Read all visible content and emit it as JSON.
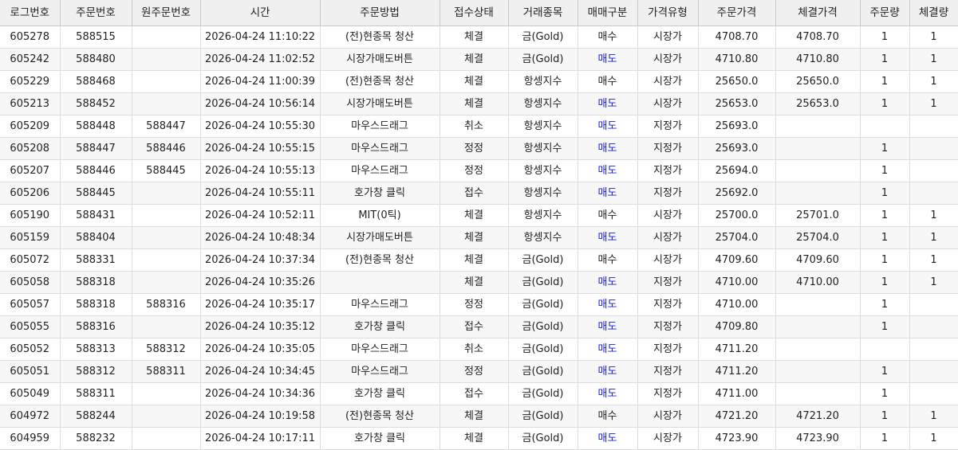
{
  "colors": {
    "sell": "#1a22d0",
    "header_bg": "#f0f0f0",
    "alt_row": "#f7f7f7"
  },
  "columns": [
    "로그번호",
    "주문번호",
    "원주문번호",
    "시간",
    "주문방법",
    "접수상태",
    "거래종목",
    "매매구분",
    "가격유형",
    "주문가격",
    "체결가격",
    "주문량",
    "체결량"
  ],
  "rows": [
    [
      "605278",
      "588515",
      "",
      "2026-04-24 11:10:22",
      "(전)현종목 청산",
      "체결",
      "금(Gold)",
      "매수",
      "시장가",
      "4708.70",
      "4708.70",
      "1",
      "1"
    ],
    [
      "605242",
      "588480",
      "",
      "2026-04-24 11:02:52",
      "시장가매도버튼",
      "체결",
      "금(Gold)",
      "매도",
      "시장가",
      "4710.80",
      "4710.80",
      "1",
      "1"
    ],
    [
      "605229",
      "588468",
      "",
      "2026-04-24 11:00:39",
      "(전)현종목 청산",
      "체결",
      "항셍지수",
      "매수",
      "시장가",
      "25650.0",
      "25650.0",
      "1",
      "1"
    ],
    [
      "605213",
      "588452",
      "",
      "2026-04-24 10:56:14",
      "시장가매도버튼",
      "체결",
      "항셍지수",
      "매도",
      "시장가",
      "25653.0",
      "25653.0",
      "1",
      "1"
    ],
    [
      "605209",
      "588448",
      "588447",
      "2026-04-24 10:55:30",
      "마우스드래그",
      "취소",
      "항셍지수",
      "매도",
      "지정가",
      "25693.0",
      "",
      "",
      ""
    ],
    [
      "605208",
      "588447",
      "588446",
      "2026-04-24 10:55:15",
      "마우스드래그",
      "정정",
      "항셍지수",
      "매도",
      "지정가",
      "25693.0",
      "",
      "1",
      ""
    ],
    [
      "605207",
      "588446",
      "588445",
      "2026-04-24 10:55:13",
      "마우스드래그",
      "정정",
      "항셍지수",
      "매도",
      "지정가",
      "25694.0",
      "",
      "1",
      ""
    ],
    [
      "605206",
      "588445",
      "",
      "2026-04-24 10:55:11",
      "호가창 클릭",
      "접수",
      "항셍지수",
      "매도",
      "지정가",
      "25692.0",
      "",
      "1",
      ""
    ],
    [
      "605190",
      "588431",
      "",
      "2026-04-24 10:52:11",
      "MIT(0틱)",
      "체결",
      "항셍지수",
      "매수",
      "시장가",
      "25700.0",
      "25701.0",
      "1",
      "1"
    ],
    [
      "605159",
      "588404",
      "",
      "2026-04-24 10:48:34",
      "시장가매도버튼",
      "체결",
      "항셍지수",
      "매도",
      "시장가",
      "25704.0",
      "25704.0",
      "1",
      "1"
    ],
    [
      "605072",
      "588331",
      "",
      "2026-04-24 10:37:34",
      "(전)현종목 청산",
      "체결",
      "금(Gold)",
      "매수",
      "시장가",
      "4709.60",
      "4709.60",
      "1",
      "1"
    ],
    [
      "605058",
      "588318",
      "",
      "2026-04-24 10:35:26",
      "",
      "체결",
      "금(Gold)",
      "매도",
      "지정가",
      "4710.00",
      "4710.00",
      "1",
      "1"
    ],
    [
      "605057",
      "588318",
      "588316",
      "2026-04-24 10:35:17",
      "마우스드래그",
      "정정",
      "금(Gold)",
      "매도",
      "지정가",
      "4710.00",
      "",
      "1",
      ""
    ],
    [
      "605055",
      "588316",
      "",
      "2026-04-24 10:35:12",
      "호가창 클릭",
      "접수",
      "금(Gold)",
      "매도",
      "지정가",
      "4709.80",
      "",
      "1",
      ""
    ],
    [
      "605052",
      "588313",
      "588312",
      "2026-04-24 10:35:05",
      "마우스드래그",
      "취소",
      "금(Gold)",
      "매도",
      "지정가",
      "4711.20",
      "",
      "",
      ""
    ],
    [
      "605051",
      "588312",
      "588311",
      "2026-04-24 10:34:45",
      "마우스드래그",
      "정정",
      "금(Gold)",
      "매도",
      "지정가",
      "4711.20",
      "",
      "1",
      ""
    ],
    [
      "605049",
      "588311",
      "",
      "2026-04-24 10:34:36",
      "호가창 클릭",
      "접수",
      "금(Gold)",
      "매도",
      "지정가",
      "4711.00",
      "",
      "1",
      ""
    ],
    [
      "604972",
      "588244",
      "",
      "2026-04-24 10:19:58",
      "(전)현종목 청산",
      "체결",
      "금(Gold)",
      "매수",
      "시장가",
      "4721.20",
      "4721.20",
      "1",
      "1"
    ],
    [
      "604959",
      "588232",
      "",
      "2026-04-24 10:17:11",
      "호가창 클릭",
      "체결",
      "금(Gold)",
      "매도",
      "시장가",
      "4723.90",
      "4723.90",
      "1",
      "1"
    ]
  ]
}
